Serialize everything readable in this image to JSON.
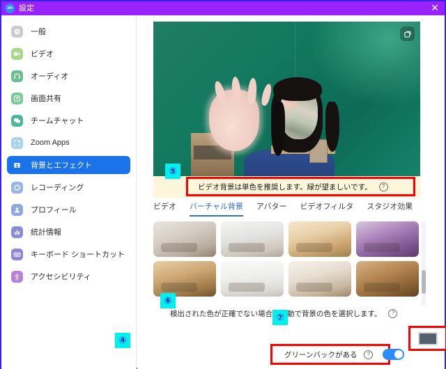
{
  "window": {
    "title": "設定",
    "logo_text": "zm",
    "logo_name": "zoom-logo",
    "close_label": "✕",
    "border_color": "#3722e6",
    "titlebar_color": "#9922ff"
  },
  "sidebar": {
    "items": [
      {
        "label": "一般",
        "icon": "gear-icon",
        "color": "#c9ccd1",
        "selected": false
      },
      {
        "label": "ビデオ",
        "icon": "camera-icon",
        "color": "#a8d98a",
        "selected": false
      },
      {
        "label": "オーディオ",
        "icon": "headphones-icon",
        "color": "#6fbf8e",
        "selected": false
      },
      {
        "label": "画面共有",
        "icon": "share-screen-icon",
        "color": "#7ec99a",
        "selected": false
      },
      {
        "label": "チームチャット",
        "icon": "chat-icon",
        "color": "#4eb89a",
        "selected": false
      },
      {
        "label": "Zoom Apps",
        "icon": "apps-icon",
        "color": "#a7d3ef",
        "selected": false
      },
      {
        "label": "背景とエフェクト",
        "icon": "background-icon",
        "color": "#1a73e8",
        "selected": true
      },
      {
        "label": "レコーディング",
        "icon": "record-icon",
        "color": "#9ab6e8",
        "selected": false
      },
      {
        "label": "プロフィール",
        "icon": "profile-icon",
        "color": "#8fa8dd",
        "selected": false
      },
      {
        "label": "統計情報",
        "icon": "stats-icon",
        "color": "#8a8ed6",
        "selected": false
      },
      {
        "label": "キーボード ショートカット",
        "icon": "keyboard-icon",
        "color": "#8f86d4",
        "selected": false
      },
      {
        "label": "アクセシビリティ",
        "icon": "accessibility-icon",
        "color": "#bb7fd6",
        "selected": false
      }
    ],
    "selected_bg": "#1a73e8"
  },
  "preview": {
    "flip_icon": "camera-flip-icon",
    "background_color": "#14795f"
  },
  "hint": {
    "text": "ビデオ背景は単色を推奨します。緑が望ましいです。",
    "help_icon": "help-icon",
    "help_glyph": "?",
    "banner_color": "#fdf6da",
    "highlight_color": "#ff0000"
  },
  "tabs": [
    {
      "label": "ビデオ",
      "active": false
    },
    {
      "label": "バーチャル背景",
      "active": true
    },
    {
      "label": "アバター",
      "active": false
    },
    {
      "label": "ビデオフィルタ",
      "active": false
    },
    {
      "label": "スタジオ効果",
      "active": false
    }
  ],
  "backgrounds": [
    {
      "name": "living-room-grey-sofa"
    },
    {
      "name": "modern-white-living-room"
    },
    {
      "name": "illustrated-bench-plants"
    },
    {
      "name": "purple-velvet-sofa"
    },
    {
      "name": "warm-lamp-lounge"
    },
    {
      "name": "gallery-wall-frames"
    },
    {
      "name": "bright-scandi-room"
    },
    {
      "name": "wooden-loft-interior"
    }
  ],
  "note": {
    "text": "検出された色が正確でない場合、手動で背景の色を選択します。",
    "help_icon": "help-icon",
    "help_glyph": "?"
  },
  "color_picker": {
    "name": "background-color-swatch",
    "value": "#54606b"
  },
  "greenscreen": {
    "label": "グリーンバックがある",
    "help_glyph": "?",
    "enabled": true,
    "switch_color": "#2d8cff"
  },
  "callouts": [
    {
      "id": 4,
      "glyph": "④"
    },
    {
      "id": 5,
      "glyph": "⑤"
    },
    {
      "id": 6,
      "glyph": "⑥"
    },
    {
      "id": 7,
      "glyph": "⑦"
    }
  ],
  "scrollbar": {
    "name": "background-grid-scrollbar"
  }
}
